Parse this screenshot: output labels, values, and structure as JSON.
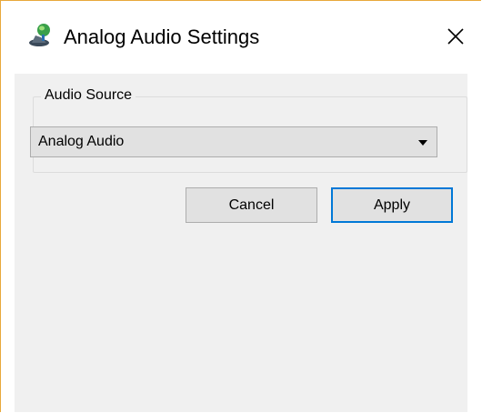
{
  "window": {
    "title": "Analog Audio Settings",
    "icon": "audio-device-icon",
    "close_glyph": "✕",
    "accent_color": "#e8a93b"
  },
  "audio_source": {
    "group_label": "Audio Source",
    "selected": "Analog Audio"
  },
  "buttons": {
    "cancel": "Cancel",
    "apply": "Apply",
    "default_border_color": "#0078d7"
  }
}
